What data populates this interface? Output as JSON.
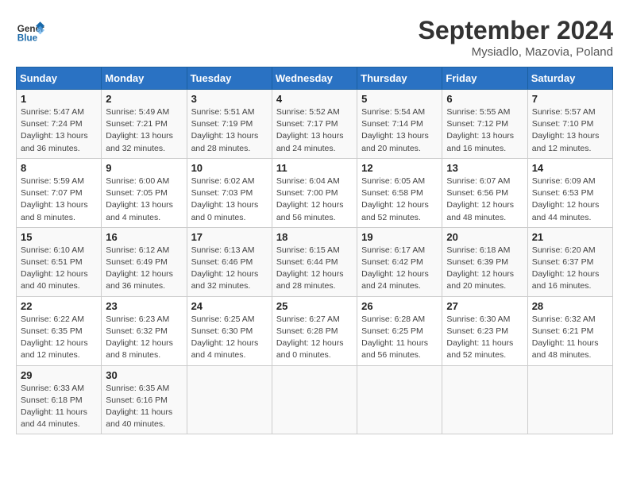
{
  "header": {
    "logo_general": "General",
    "logo_blue": "Blue",
    "month": "September 2024",
    "location": "Mysiadlo, Mazovia, Poland"
  },
  "weekdays": [
    "Sunday",
    "Monday",
    "Tuesday",
    "Wednesday",
    "Thursday",
    "Friday",
    "Saturday"
  ],
  "weeks": [
    [
      {
        "day": "1",
        "info": "Sunrise: 5:47 AM\nSunset: 7:24 PM\nDaylight: 13 hours\nand 36 minutes."
      },
      {
        "day": "2",
        "info": "Sunrise: 5:49 AM\nSunset: 7:21 PM\nDaylight: 13 hours\nand 32 minutes."
      },
      {
        "day": "3",
        "info": "Sunrise: 5:51 AM\nSunset: 7:19 PM\nDaylight: 13 hours\nand 28 minutes."
      },
      {
        "day": "4",
        "info": "Sunrise: 5:52 AM\nSunset: 7:17 PM\nDaylight: 13 hours\nand 24 minutes."
      },
      {
        "day": "5",
        "info": "Sunrise: 5:54 AM\nSunset: 7:14 PM\nDaylight: 13 hours\nand 20 minutes."
      },
      {
        "day": "6",
        "info": "Sunrise: 5:55 AM\nSunset: 7:12 PM\nDaylight: 13 hours\nand 16 minutes."
      },
      {
        "day": "7",
        "info": "Sunrise: 5:57 AM\nSunset: 7:10 PM\nDaylight: 13 hours\nand 12 minutes."
      }
    ],
    [
      {
        "day": "8",
        "info": "Sunrise: 5:59 AM\nSunset: 7:07 PM\nDaylight: 13 hours\nand 8 minutes."
      },
      {
        "day": "9",
        "info": "Sunrise: 6:00 AM\nSunset: 7:05 PM\nDaylight: 13 hours\nand 4 minutes."
      },
      {
        "day": "10",
        "info": "Sunrise: 6:02 AM\nSunset: 7:03 PM\nDaylight: 13 hours\nand 0 minutes."
      },
      {
        "day": "11",
        "info": "Sunrise: 6:04 AM\nSunset: 7:00 PM\nDaylight: 12 hours\nand 56 minutes."
      },
      {
        "day": "12",
        "info": "Sunrise: 6:05 AM\nSunset: 6:58 PM\nDaylight: 12 hours\nand 52 minutes."
      },
      {
        "day": "13",
        "info": "Sunrise: 6:07 AM\nSunset: 6:56 PM\nDaylight: 12 hours\nand 48 minutes."
      },
      {
        "day": "14",
        "info": "Sunrise: 6:09 AM\nSunset: 6:53 PM\nDaylight: 12 hours\nand 44 minutes."
      }
    ],
    [
      {
        "day": "15",
        "info": "Sunrise: 6:10 AM\nSunset: 6:51 PM\nDaylight: 12 hours\nand 40 minutes."
      },
      {
        "day": "16",
        "info": "Sunrise: 6:12 AM\nSunset: 6:49 PM\nDaylight: 12 hours\nand 36 minutes."
      },
      {
        "day": "17",
        "info": "Sunrise: 6:13 AM\nSunset: 6:46 PM\nDaylight: 12 hours\nand 32 minutes."
      },
      {
        "day": "18",
        "info": "Sunrise: 6:15 AM\nSunset: 6:44 PM\nDaylight: 12 hours\nand 28 minutes."
      },
      {
        "day": "19",
        "info": "Sunrise: 6:17 AM\nSunset: 6:42 PM\nDaylight: 12 hours\nand 24 minutes."
      },
      {
        "day": "20",
        "info": "Sunrise: 6:18 AM\nSunset: 6:39 PM\nDaylight: 12 hours\nand 20 minutes."
      },
      {
        "day": "21",
        "info": "Sunrise: 6:20 AM\nSunset: 6:37 PM\nDaylight: 12 hours\nand 16 minutes."
      }
    ],
    [
      {
        "day": "22",
        "info": "Sunrise: 6:22 AM\nSunset: 6:35 PM\nDaylight: 12 hours\nand 12 minutes."
      },
      {
        "day": "23",
        "info": "Sunrise: 6:23 AM\nSunset: 6:32 PM\nDaylight: 12 hours\nand 8 minutes."
      },
      {
        "day": "24",
        "info": "Sunrise: 6:25 AM\nSunset: 6:30 PM\nDaylight: 12 hours\nand 4 minutes."
      },
      {
        "day": "25",
        "info": "Sunrise: 6:27 AM\nSunset: 6:28 PM\nDaylight: 12 hours\nand 0 minutes."
      },
      {
        "day": "26",
        "info": "Sunrise: 6:28 AM\nSunset: 6:25 PM\nDaylight: 11 hours\nand 56 minutes."
      },
      {
        "day": "27",
        "info": "Sunrise: 6:30 AM\nSunset: 6:23 PM\nDaylight: 11 hours\nand 52 minutes."
      },
      {
        "day": "28",
        "info": "Sunrise: 6:32 AM\nSunset: 6:21 PM\nDaylight: 11 hours\nand 48 minutes."
      }
    ],
    [
      {
        "day": "29",
        "info": "Sunrise: 6:33 AM\nSunset: 6:18 PM\nDaylight: 11 hours\nand 44 minutes."
      },
      {
        "day": "30",
        "info": "Sunrise: 6:35 AM\nSunset: 6:16 PM\nDaylight: 11 hours\nand 40 minutes."
      },
      {
        "day": "",
        "info": ""
      },
      {
        "day": "",
        "info": ""
      },
      {
        "day": "",
        "info": ""
      },
      {
        "day": "",
        "info": ""
      },
      {
        "day": "",
        "info": ""
      }
    ]
  ]
}
